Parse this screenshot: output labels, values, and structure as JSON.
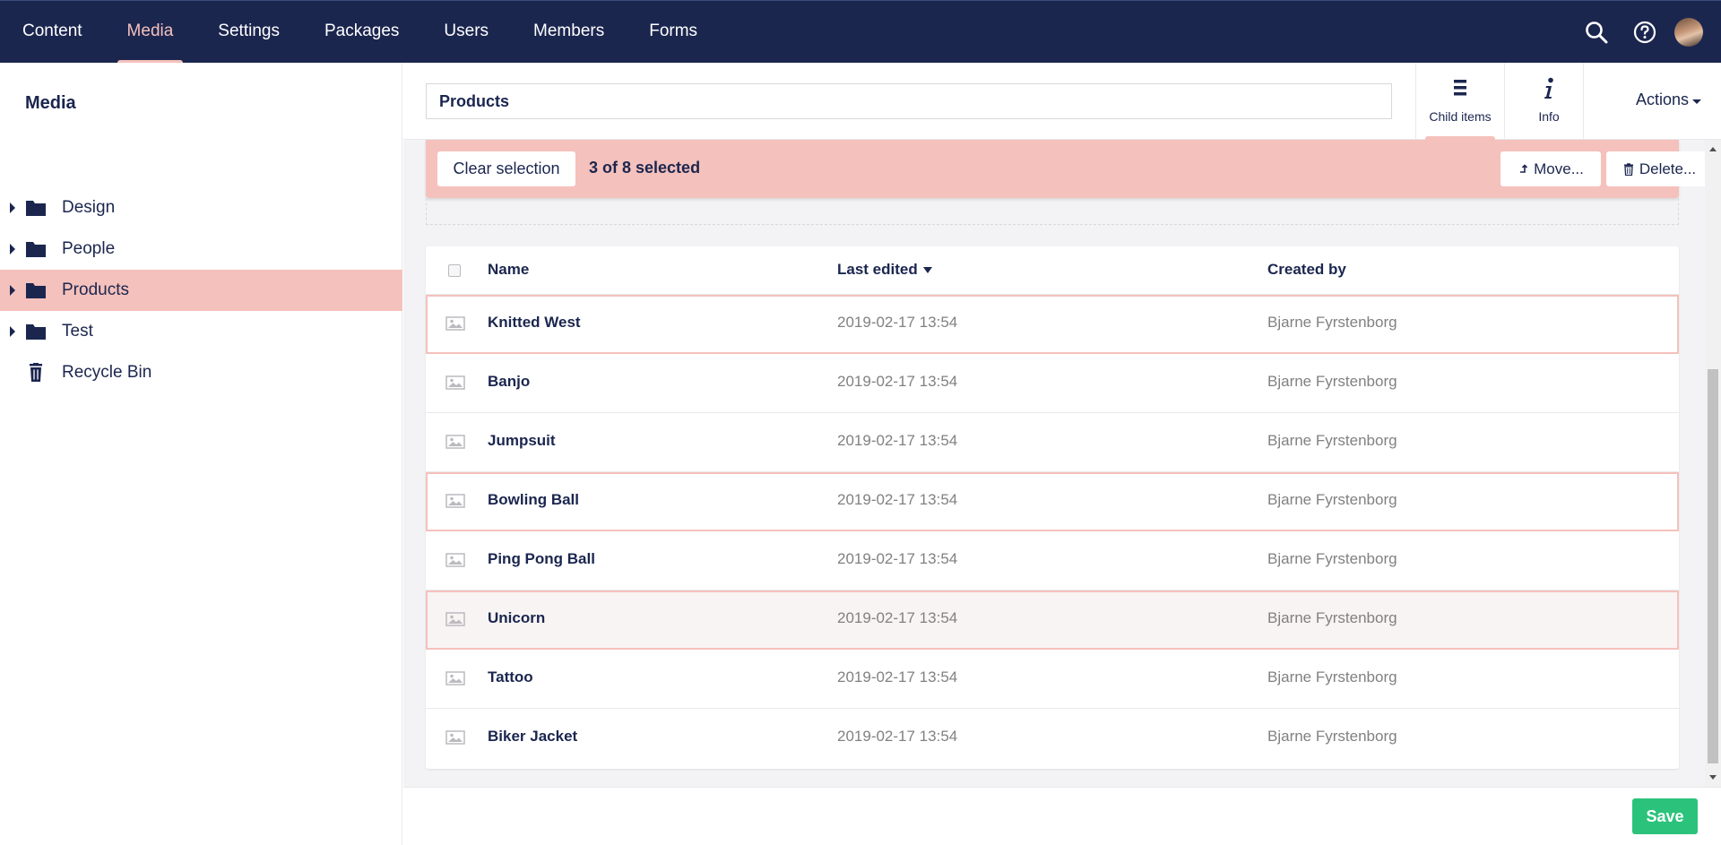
{
  "topnav": {
    "items": [
      {
        "label": "Content"
      },
      {
        "label": "Media",
        "active": true
      },
      {
        "label": "Settings"
      },
      {
        "label": "Packages"
      },
      {
        "label": "Users"
      },
      {
        "label": "Members"
      },
      {
        "label": "Forms"
      }
    ],
    "icons": [
      "search-icon",
      "help-icon",
      "user-avatar"
    ]
  },
  "sidebar": {
    "title": "Media",
    "items": [
      {
        "label": "Design",
        "icon": "folder-icon",
        "has_children": true
      },
      {
        "label": "People",
        "icon": "folder-icon",
        "has_children": true
      },
      {
        "label": "Products",
        "icon": "folder-icon",
        "has_children": true,
        "active": true
      },
      {
        "label": "Test",
        "icon": "folder-icon",
        "has_children": true
      },
      {
        "label": "Recycle Bin",
        "icon": "trash-icon",
        "has_children": false
      }
    ]
  },
  "header": {
    "name_value": "Products",
    "apps": [
      {
        "label": "Child items",
        "icon": "list-icon",
        "active": true
      },
      {
        "label": "Info",
        "icon": "info-icon"
      }
    ],
    "actions_label": "Actions"
  },
  "selection": {
    "clear_label": "Clear selection",
    "count_text": "3 of 8 selected",
    "move_label": "Move...",
    "delete_label": "Delete..."
  },
  "table": {
    "columns": {
      "name": "Name",
      "last_edited": "Last edited",
      "created_by": "Created by"
    },
    "sort_column": "Last edited",
    "rows": [
      {
        "name": "Knitted West",
        "date": "2019-02-17 13:54",
        "user": "Bjarne Fyrstenborg",
        "selected": true
      },
      {
        "name": "Banjo",
        "date": "2019-02-17 13:54",
        "user": "Bjarne Fyrstenborg",
        "selected": false
      },
      {
        "name": "Jumpsuit",
        "date": "2019-02-17 13:54",
        "user": "Bjarne Fyrstenborg",
        "selected": false
      },
      {
        "name": "Bowling Ball",
        "date": "2019-02-17 13:54",
        "user": "Bjarne Fyrstenborg",
        "selected": true
      },
      {
        "name": "Ping Pong Ball",
        "date": "2019-02-17 13:54",
        "user": "Bjarne Fyrstenborg",
        "selected": false
      },
      {
        "name": "Unicorn",
        "date": "2019-02-17 13:54",
        "user": "Bjarne Fyrstenborg",
        "selected": true
      },
      {
        "name": "Tattoo",
        "date": "2019-02-17 13:54",
        "user": "Bjarne Fyrstenborg",
        "selected": false
      },
      {
        "name": "Biker Jacket",
        "date": "2019-02-17 13:54",
        "user": "Bjarne Fyrstenborg",
        "selected": false
      }
    ]
  },
  "footer": {
    "save_label": "Save"
  },
  "colors": {
    "nav_bg": "#1b264f",
    "accent": "#f5c1bc",
    "save": "#2bc37c"
  }
}
